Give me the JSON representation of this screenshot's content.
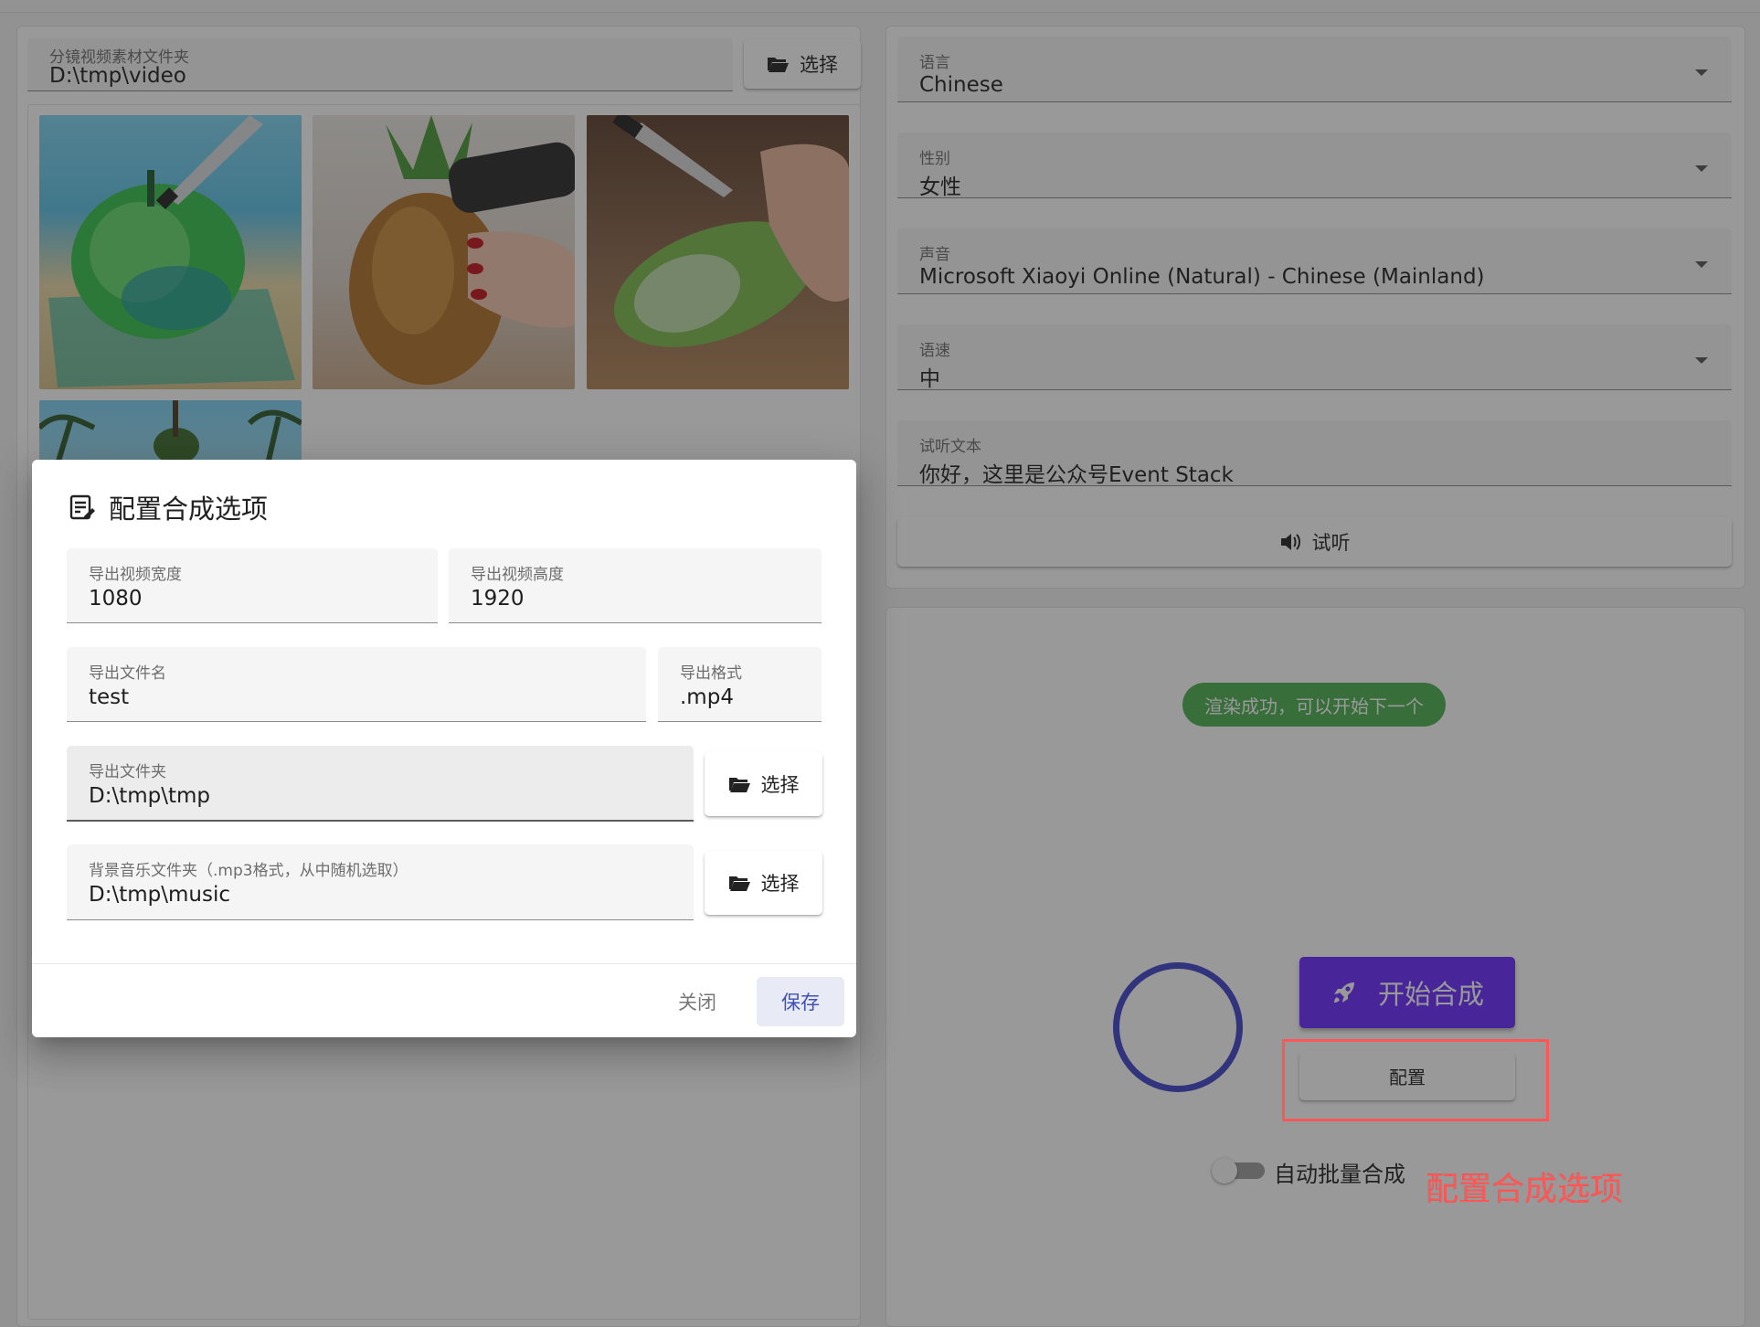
{
  "left_panel": {
    "folder_field": {
      "label": "分镜视频素材文件夹",
      "value": "D:\\tmp\\video"
    },
    "select_button": "选择",
    "thumbnails": [
      "glass-apple-icon",
      "glass-pineapple-icon",
      "glass-cucumber-icon",
      "palm-beach-icon"
    ]
  },
  "voice_panel": {
    "language": {
      "label": "语言",
      "value": "Chinese"
    },
    "gender": {
      "label": "性别",
      "value": "女性"
    },
    "voice": {
      "label": "声音",
      "value": "Microsoft Xiaoyi Online (Natural) - Chinese (Mainland)"
    },
    "speed": {
      "label": "语速",
      "value": "中"
    },
    "preview_text": {
      "label": "试听文本",
      "value": "你好，这里是公众号Event Stack"
    },
    "preview_button": "试听"
  },
  "render_panel": {
    "status_badge": "渲染成功，可以开始下一个",
    "start_button": "开始合成",
    "config_button": "配置",
    "auto_batch_label": "自动批量合成",
    "auto_batch_enabled": false,
    "annotation": "配置合成选项",
    "colors": {
      "primary": "#6a2bff",
      "success": "#4caf50",
      "annotation": "#ff5656",
      "spinner": "#3f44c9"
    }
  },
  "dialog": {
    "title": "配置合成选项",
    "width_field": {
      "label": "导出视频宽度",
      "value": "1080"
    },
    "height_field": {
      "label": "导出视频高度",
      "value": "1920"
    },
    "filename_field": {
      "label": "导出文件名",
      "value": "test"
    },
    "format_field": {
      "label": "导出格式",
      "value": ".mp4"
    },
    "output_folder": {
      "label": "导出文件夹",
      "value": "D:\\tmp\\tmp"
    },
    "music_folder": {
      "label": "背景音乐文件夹（.mp3格式，从中随机选取）",
      "value": "D:\\tmp\\music"
    },
    "select_label": "选择",
    "close_button": "关闭",
    "save_button": "保存",
    "save_color": "#3f51b5"
  }
}
